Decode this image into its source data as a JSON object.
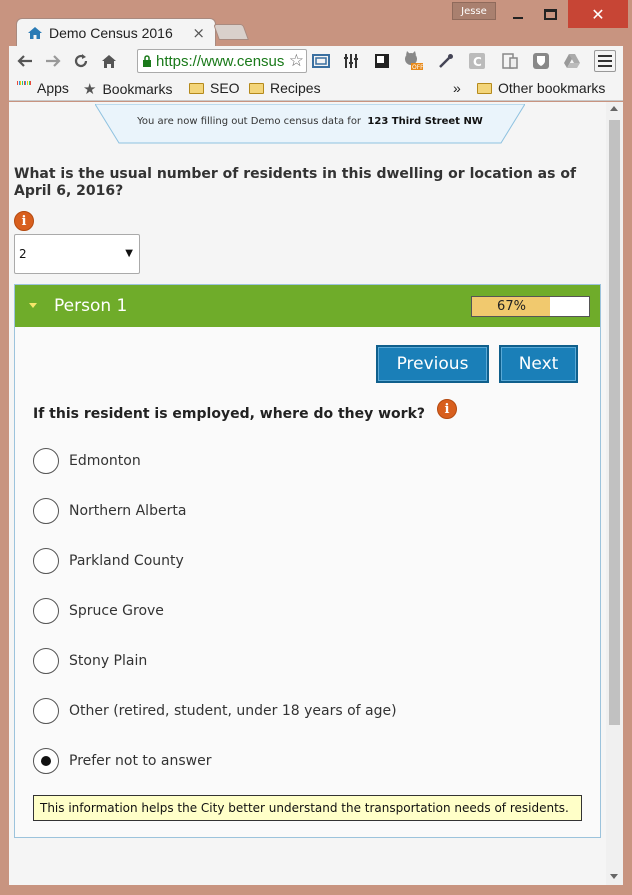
{
  "window": {
    "user_badge": "Jesse",
    "close_glyph": "✕"
  },
  "tab": {
    "title": "Demo Census 2016",
    "icon": "home-icon",
    "close_glyph": "×"
  },
  "toolbar": {
    "url": "https://www.census",
    "icons": [
      "back-icon",
      "forward-icon",
      "reload-icon",
      "home-icon",
      "bookmark-star-icon"
    ]
  },
  "bookmarks": {
    "apps_label": "Apps",
    "bookmarks_label": "Bookmarks",
    "seo_label": "SEO",
    "recipes_label": "Recipes",
    "overflow": "»",
    "other_label": "Other bookmarks"
  },
  "notice": {
    "prefix": "You are now filling out Demo census data for",
    "address": "123 Third Street NW"
  },
  "residents": {
    "question": "What is the usual number of residents in this dwelling or location as of April 6, 2016?",
    "selected": "2"
  },
  "person": {
    "title": "Person 1",
    "progress_label": "67%",
    "progress_fraction": 0.67,
    "previous_label": "Previous",
    "next_label": "Next",
    "question": "If this resident is employed, where do they work?",
    "options": [
      {
        "label": "Edmonton",
        "checked": false
      },
      {
        "label": "Northern Alberta",
        "checked": false
      },
      {
        "label": "Parkland County",
        "checked": false
      },
      {
        "label": "Spruce Grove",
        "checked": false
      },
      {
        "label": "Stony Plain",
        "checked": false
      },
      {
        "label": "Other (retired, student, under 18 years of age)",
        "checked": false
      },
      {
        "label": "Prefer not to answer",
        "checked": true
      }
    ],
    "help_text": "This information helps the City better understand the transportation needs of residents."
  },
  "colors": {
    "header_green": "#6fac2a",
    "button_blue": "#1a7fb8",
    "info_orange": "#d85f1e",
    "progress_fill": "#f1c96e",
    "tooltip_bg": "#ffffc8"
  }
}
